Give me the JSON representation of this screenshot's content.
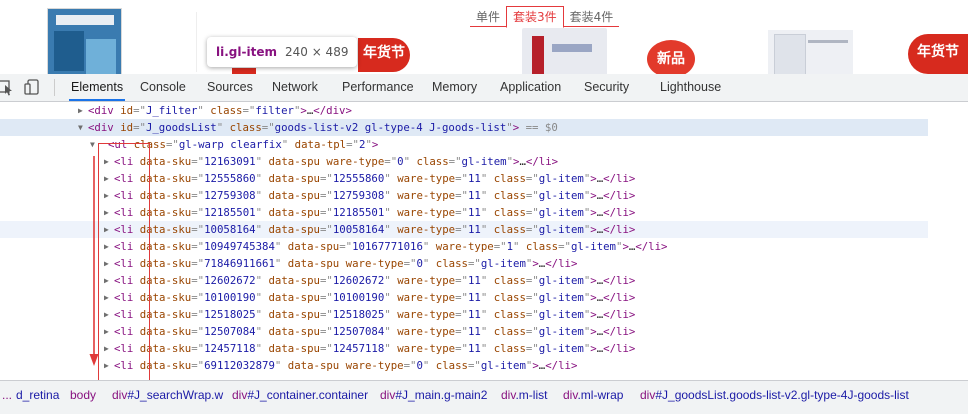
{
  "top": {
    "tabs": [
      "单件",
      "套装3件",
      "套装4件"
    ],
    "active_tab_index": 1,
    "badges": [
      "年货节",
      "新品",
      "年货节"
    ],
    "tooltip": {
      "selector": "li.gl-item",
      "size": "240 × 489"
    }
  },
  "devtools": {
    "tabs": [
      "Elements",
      "Console",
      "Sources",
      "Network",
      "Performance",
      "Memory",
      "Application",
      "Security",
      "Lighthouse"
    ],
    "active": "Elements"
  },
  "tree": {
    "rows": [
      {
        "arrow": "▶",
        "tokens": [
          [
            "t",
            "<div "
          ],
          [
            "an",
            "id"
          ],
          [
            "eq",
            "=\""
          ],
          [
            "av",
            "J_filter"
          ],
          [
            "eq",
            "\" "
          ],
          [
            "an",
            "class"
          ],
          [
            "eq",
            "=\""
          ],
          [
            "av",
            "filter"
          ],
          [
            "eq",
            "\""
          ],
          [
            "t",
            ">"
          ],
          [
            "tx",
            "…"
          ],
          [
            "t",
            "</div>"
          ]
        ]
      },
      {
        "arrow": "▼",
        "tokens": [
          [
            "t",
            "<div "
          ],
          [
            "an",
            "id"
          ],
          [
            "eq",
            "=\""
          ],
          [
            "av",
            "J_goodsList"
          ],
          [
            "eq",
            "\" "
          ],
          [
            "an",
            "class"
          ],
          [
            "eq",
            "=\""
          ],
          [
            "av",
            "goods-list-v2 gl-type-4 J-goods-list"
          ],
          [
            "eq",
            "\""
          ],
          [
            "t",
            ">"
          ],
          [
            "eq",
            " == $0"
          ]
        ]
      },
      {
        "arrow": "▼",
        "tokens": [
          [
            "t",
            "<ul "
          ],
          [
            "an",
            "class"
          ],
          [
            "eq",
            "=\""
          ],
          [
            "av",
            "gl-warp clearfix"
          ],
          [
            "eq",
            "\" "
          ],
          [
            "an",
            "data-tpl"
          ],
          [
            "eq",
            "=\""
          ],
          [
            "av",
            "2"
          ],
          [
            "eq",
            "\""
          ],
          [
            "t",
            ">"
          ]
        ]
      },
      {
        "arrow": "▶",
        "tokens": [
          [
            "t",
            "<li "
          ],
          [
            "an",
            "data-sku"
          ],
          [
            "eq",
            "=\""
          ],
          [
            "av",
            "12163091"
          ],
          [
            "eq",
            "\" "
          ],
          [
            "an",
            "data-spu ware-type"
          ],
          [
            "eq",
            "=\""
          ],
          [
            "av",
            "0"
          ],
          [
            "eq",
            "\" "
          ],
          [
            "an",
            "class"
          ],
          [
            "eq",
            "=\""
          ],
          [
            "av",
            "gl-item"
          ],
          [
            "eq",
            "\""
          ],
          [
            "t",
            ">"
          ],
          [
            "tx",
            "…"
          ],
          [
            "t",
            "</li>"
          ]
        ]
      },
      {
        "arrow": "▶",
        "tokens": [
          [
            "t",
            "<li "
          ],
          [
            "an",
            "data-sku"
          ],
          [
            "eq",
            "=\""
          ],
          [
            "av",
            "12555860"
          ],
          [
            "eq",
            "\" "
          ],
          [
            "an",
            "data-spu"
          ],
          [
            "eq",
            "=\""
          ],
          [
            "av",
            "12555860"
          ],
          [
            "eq",
            "\" "
          ],
          [
            "an",
            "ware-type"
          ],
          [
            "eq",
            "=\""
          ],
          [
            "av",
            "11"
          ],
          [
            "eq",
            "\" "
          ],
          [
            "an",
            "class"
          ],
          [
            "eq",
            "=\""
          ],
          [
            "av",
            "gl-item"
          ],
          [
            "eq",
            "\""
          ],
          [
            "t",
            ">"
          ],
          [
            "tx",
            "…"
          ],
          [
            "t",
            "</li>"
          ]
        ]
      },
      {
        "arrow": "▶",
        "tokens": [
          [
            "t",
            "<li "
          ],
          [
            "an",
            "data-sku"
          ],
          [
            "eq",
            "=\""
          ],
          [
            "av",
            "12759308"
          ],
          [
            "eq",
            "\" "
          ],
          [
            "an",
            "data-spu"
          ],
          [
            "eq",
            "=\""
          ],
          [
            "av",
            "12759308"
          ],
          [
            "eq",
            "\" "
          ],
          [
            "an",
            "ware-type"
          ],
          [
            "eq",
            "=\""
          ],
          [
            "av",
            "11"
          ],
          [
            "eq",
            "\" "
          ],
          [
            "an",
            "class"
          ],
          [
            "eq",
            "=\""
          ],
          [
            "av",
            "gl-item"
          ],
          [
            "eq",
            "\""
          ],
          [
            "t",
            ">"
          ],
          [
            "tx",
            "…"
          ],
          [
            "t",
            "</li>"
          ]
        ]
      },
      {
        "arrow": "▶",
        "tokens": [
          [
            "t",
            "<li "
          ],
          [
            "an",
            "data-sku"
          ],
          [
            "eq",
            "=\""
          ],
          [
            "av",
            "12185501"
          ],
          [
            "eq",
            "\" "
          ],
          [
            "an",
            "data-spu"
          ],
          [
            "eq",
            "=\""
          ],
          [
            "av",
            "12185501"
          ],
          [
            "eq",
            "\" "
          ],
          [
            "an",
            "ware-type"
          ],
          [
            "eq",
            "=\""
          ],
          [
            "av",
            "11"
          ],
          [
            "eq",
            "\" "
          ],
          [
            "an",
            "class"
          ],
          [
            "eq",
            "=\""
          ],
          [
            "av",
            "gl-item"
          ],
          [
            "eq",
            "\""
          ],
          [
            "t",
            ">"
          ],
          [
            "tx",
            "…"
          ],
          [
            "t",
            "</li>"
          ]
        ]
      },
      {
        "arrow": "▶",
        "tokens": [
          [
            "t",
            "<li "
          ],
          [
            "an",
            "data-sku"
          ],
          [
            "eq",
            "=\""
          ],
          [
            "av",
            "10058164"
          ],
          [
            "eq",
            "\" "
          ],
          [
            "an",
            "data-spu"
          ],
          [
            "eq",
            "=\""
          ],
          [
            "av",
            "10058164"
          ],
          [
            "eq",
            "\" "
          ],
          [
            "an",
            "ware-type"
          ],
          [
            "eq",
            "=\""
          ],
          [
            "av",
            "11"
          ],
          [
            "eq",
            "\" "
          ],
          [
            "an",
            "class"
          ],
          [
            "eq",
            "=\""
          ],
          [
            "av",
            "gl-item"
          ],
          [
            "eq",
            "\""
          ],
          [
            "t",
            ">"
          ],
          [
            "tx",
            "…"
          ],
          [
            "t",
            "</li>"
          ]
        ]
      },
      {
        "arrow": "▶",
        "tokens": [
          [
            "t",
            "<li "
          ],
          [
            "an",
            "data-sku"
          ],
          [
            "eq",
            "=\""
          ],
          [
            "av",
            "10949745384"
          ],
          [
            "eq",
            "\" "
          ],
          [
            "an",
            "data-spu"
          ],
          [
            "eq",
            "=\""
          ],
          [
            "av",
            "10167771016"
          ],
          [
            "eq",
            "\" "
          ],
          [
            "an",
            "ware-type"
          ],
          [
            "eq",
            "=\""
          ],
          [
            "av",
            "1"
          ],
          [
            "eq",
            "\" "
          ],
          [
            "an",
            "class"
          ],
          [
            "eq",
            "=\""
          ],
          [
            "av",
            "gl-item"
          ],
          [
            "eq",
            "\""
          ],
          [
            "t",
            ">"
          ],
          [
            "tx",
            "…"
          ],
          [
            "t",
            "</li>"
          ]
        ]
      },
      {
        "arrow": "▶",
        "tokens": [
          [
            "t",
            "<li "
          ],
          [
            "an",
            "data-sku"
          ],
          [
            "eq",
            "=\""
          ],
          [
            "av",
            "71846911661"
          ],
          [
            "eq",
            "\" "
          ],
          [
            "an",
            "data-spu ware-type"
          ],
          [
            "eq",
            "=\""
          ],
          [
            "av",
            "0"
          ],
          [
            "eq",
            "\" "
          ],
          [
            "an",
            "class"
          ],
          [
            "eq",
            "=\""
          ],
          [
            "av",
            "gl-item"
          ],
          [
            "eq",
            "\""
          ],
          [
            "t",
            ">"
          ],
          [
            "tx",
            "…"
          ],
          [
            "t",
            "</li>"
          ]
        ]
      },
      {
        "arrow": "▶",
        "tokens": [
          [
            "t",
            "<li "
          ],
          [
            "an",
            "data-sku"
          ],
          [
            "eq",
            "=\""
          ],
          [
            "av",
            "12602672"
          ],
          [
            "eq",
            "\" "
          ],
          [
            "an",
            "data-spu"
          ],
          [
            "eq",
            "=\""
          ],
          [
            "av",
            "12602672"
          ],
          [
            "eq",
            "\" "
          ],
          [
            "an",
            "ware-type"
          ],
          [
            "eq",
            "=\""
          ],
          [
            "av",
            "11"
          ],
          [
            "eq",
            "\" "
          ],
          [
            "an",
            "class"
          ],
          [
            "eq",
            "=\""
          ],
          [
            "av",
            "gl-item"
          ],
          [
            "eq",
            "\""
          ],
          [
            "t",
            ">"
          ],
          [
            "tx",
            "…"
          ],
          [
            "t",
            "</li>"
          ]
        ]
      },
      {
        "arrow": "▶",
        "tokens": [
          [
            "t",
            "<li "
          ],
          [
            "an",
            "data-sku"
          ],
          [
            "eq",
            "=\""
          ],
          [
            "av",
            "10100190"
          ],
          [
            "eq",
            "\" "
          ],
          [
            "an",
            "data-spu"
          ],
          [
            "eq",
            "=\""
          ],
          [
            "av",
            "10100190"
          ],
          [
            "eq",
            "\" "
          ],
          [
            "an",
            "ware-type"
          ],
          [
            "eq",
            "=\""
          ],
          [
            "av",
            "11"
          ],
          [
            "eq",
            "\" "
          ],
          [
            "an",
            "class"
          ],
          [
            "eq",
            "=\""
          ],
          [
            "av",
            "gl-item"
          ],
          [
            "eq",
            "\""
          ],
          [
            "t",
            ">"
          ],
          [
            "tx",
            "…"
          ],
          [
            "t",
            "</li>"
          ]
        ]
      },
      {
        "arrow": "▶",
        "tokens": [
          [
            "t",
            "<li "
          ],
          [
            "an",
            "data-sku"
          ],
          [
            "eq",
            "=\""
          ],
          [
            "av",
            "12518025"
          ],
          [
            "eq",
            "\" "
          ],
          [
            "an",
            "data-spu"
          ],
          [
            "eq",
            "=\""
          ],
          [
            "av",
            "12518025"
          ],
          [
            "eq",
            "\" "
          ],
          [
            "an",
            "ware-type"
          ],
          [
            "eq",
            "=\""
          ],
          [
            "av",
            "11"
          ],
          [
            "eq",
            "\" "
          ],
          [
            "an",
            "class"
          ],
          [
            "eq",
            "=\""
          ],
          [
            "av",
            "gl-item"
          ],
          [
            "eq",
            "\""
          ],
          [
            "t",
            ">"
          ],
          [
            "tx",
            "…"
          ],
          [
            "t",
            "</li>"
          ]
        ]
      },
      {
        "arrow": "▶",
        "tokens": [
          [
            "t",
            "<li "
          ],
          [
            "an",
            "data-sku"
          ],
          [
            "eq",
            "=\""
          ],
          [
            "av",
            "12507084"
          ],
          [
            "eq",
            "\" "
          ],
          [
            "an",
            "data-spu"
          ],
          [
            "eq",
            "=\""
          ],
          [
            "av",
            "12507084"
          ],
          [
            "eq",
            "\" "
          ],
          [
            "an",
            "ware-type"
          ],
          [
            "eq",
            "=\""
          ],
          [
            "av",
            "11"
          ],
          [
            "eq",
            "\" "
          ],
          [
            "an",
            "class"
          ],
          [
            "eq",
            "=\""
          ],
          [
            "av",
            "gl-item"
          ],
          [
            "eq",
            "\""
          ],
          [
            "t",
            ">"
          ],
          [
            "tx",
            "…"
          ],
          [
            "t",
            "</li>"
          ]
        ]
      },
      {
        "arrow": "▶",
        "tokens": [
          [
            "t",
            "<li "
          ],
          [
            "an",
            "data-sku"
          ],
          [
            "eq",
            "=\""
          ],
          [
            "av",
            "12457118"
          ],
          [
            "eq",
            "\" "
          ],
          [
            "an",
            "data-spu"
          ],
          [
            "eq",
            "=\""
          ],
          [
            "av",
            "12457118"
          ],
          [
            "eq",
            "\" "
          ],
          [
            "an",
            "ware-type"
          ],
          [
            "eq",
            "=\""
          ],
          [
            "av",
            "11"
          ],
          [
            "eq",
            "\" "
          ],
          [
            "an",
            "class"
          ],
          [
            "eq",
            "=\""
          ],
          [
            "av",
            "gl-item"
          ],
          [
            "eq",
            "\""
          ],
          [
            "t",
            ">"
          ],
          [
            "tx",
            "…"
          ],
          [
            "t",
            "</li>"
          ]
        ]
      },
      {
        "arrow": "▶",
        "tokens": [
          [
            "t",
            "<li "
          ],
          [
            "an",
            "data-sku"
          ],
          [
            "eq",
            "=\""
          ],
          [
            "av",
            "69112032879"
          ],
          [
            "eq",
            "\" "
          ],
          [
            "an",
            "data-spu ware-type"
          ],
          [
            "eq",
            "=\""
          ],
          [
            "av",
            "0"
          ],
          [
            "eq",
            "\" "
          ],
          [
            "an",
            "class"
          ],
          [
            "eq",
            "=\""
          ],
          [
            "av",
            "gl-item"
          ],
          [
            "eq",
            "\""
          ],
          [
            "t",
            ">"
          ],
          [
            "tx",
            "…"
          ],
          [
            "t",
            "</li>"
          ]
        ]
      }
    ]
  },
  "breadcrumb": [
    {
      "tag": "...",
      "cls": ""
    },
    {
      "tag": "",
      "cls": "d_retina"
    },
    {
      "tag": "body",
      "cls": ""
    },
    {
      "tag": "div",
      "cls": "#J_searchWrap.w"
    },
    {
      "tag": "div",
      "cls": "#J_container.container"
    },
    {
      "tag": "div",
      "cls": "#J_main.g-main2"
    },
    {
      "tag": "div",
      "cls": ".m-list"
    },
    {
      "tag": "div",
      "cls": ".ml-wrap"
    },
    {
      "tag": "div",
      "cls": "#J_goodsList.goods-list-v2.gl-type-4J-goods-list"
    }
  ]
}
